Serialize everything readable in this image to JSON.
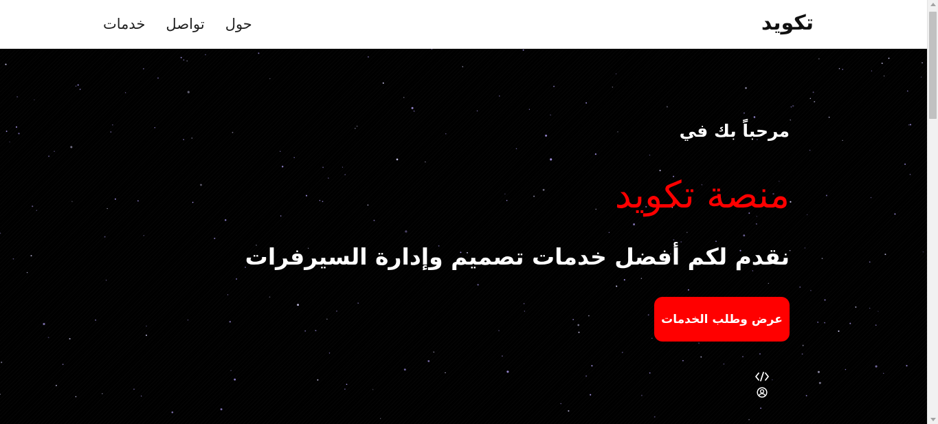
{
  "header": {
    "brand": "تكويد",
    "nav": [
      {
        "label": "خدمات"
      },
      {
        "label": "تواصل"
      },
      {
        "label": "حول"
      }
    ]
  },
  "hero": {
    "welcome": "مرحباً بك في",
    "title": "منصة تكويد",
    "subtitle": "نقدم لكم أفضل خدمات تصميم وإدارة السيرفرات",
    "cta_label": "عرض وطلب الخدمات",
    "icons": [
      "code-icon",
      "user-circle-icon"
    ]
  },
  "colors": {
    "accent": "#ff0000",
    "header_bg": "#ffffff",
    "hero_bg": "#000000",
    "text_light": "#ffffff",
    "text_dark": "#111111"
  }
}
